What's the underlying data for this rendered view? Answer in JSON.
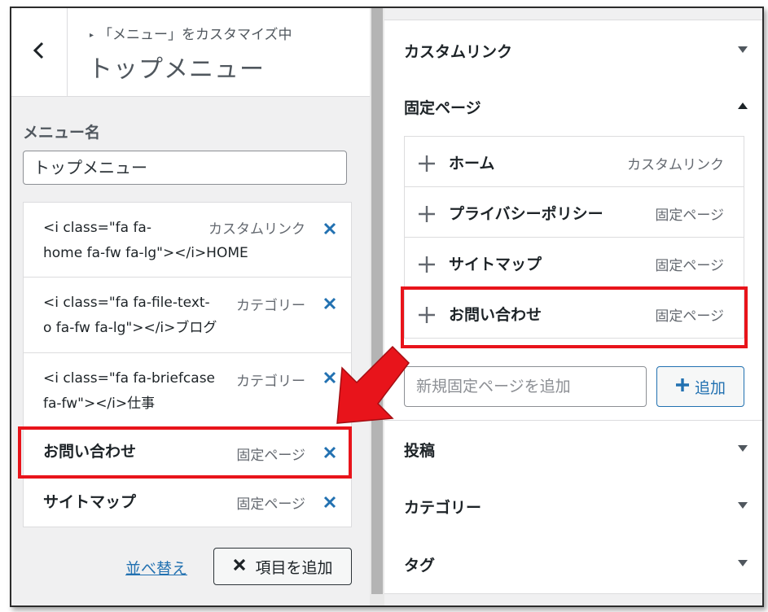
{
  "header": {
    "breadcrumb": "「メニュー」をカスタマイズ中",
    "title": "トップメニュー"
  },
  "menu_name": {
    "label": "メニュー名",
    "value": "トップメニュー"
  },
  "menu_items": [
    {
      "title": "<i class=\"fa fa-\nhome fa-fw fa-lg\"></i>HOME",
      "type": "カスタムリンク"
    },
    {
      "title": "<i class=\"fa fa-file-text-\no fa-fw fa-lg\"></i>ブログ",
      "type": "カテゴリー"
    },
    {
      "title": "<i class=\"fa fa-briefcase\nfa-fw\"></i>仕事",
      "type": "カテゴリー"
    },
    {
      "title": "お問い合わせ",
      "type": "固定ページ"
    },
    {
      "title": "サイトマップ",
      "type": "固定ページ"
    }
  ],
  "footer": {
    "sort_link": "並べ替え",
    "add_items_button": "項目を追加"
  },
  "accordions": {
    "custom_link": "カスタムリンク",
    "pages": "固定ページ",
    "posts": "投稿",
    "categories": "カテゴリー",
    "tags": "タグ"
  },
  "pages": [
    {
      "title": "ホーム",
      "type": "カスタムリンク"
    },
    {
      "title": "プライバシーポリシー",
      "type": "固定ページ"
    },
    {
      "title": "サイトマップ",
      "type": "固定ページ"
    },
    {
      "title": "お問い合わせ",
      "type": "固定ページ"
    }
  ],
  "new_page": {
    "placeholder": "新規固定ページを追加",
    "button": "追加"
  },
  "colors": {
    "highlight": "#e8141b",
    "link": "#2271b1",
    "remove_x": "#2271b1"
  },
  "icons": {
    "back": "chevron-left-icon",
    "remove": "close-icon",
    "add": "plus-icon",
    "collapse": "triangle-down-icon",
    "expand": "triangle-up-icon"
  }
}
